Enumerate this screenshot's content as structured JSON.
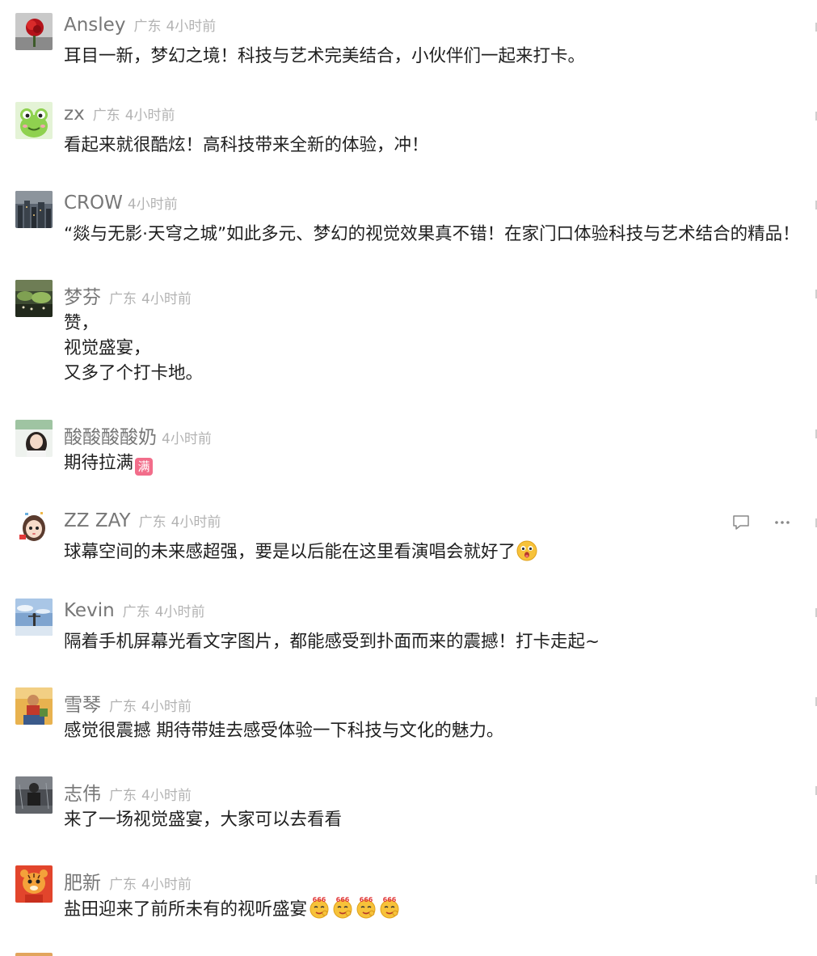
{
  "comments": [
    {
      "name": "Ansley",
      "location": "广东",
      "time": "4小时前",
      "lines": [
        "耳目一新，梦幻之境！科技与艺术完美结合，小伙伴们一起来打卡。"
      ],
      "avatar_icon": "red-rose-avatar-icon"
    },
    {
      "name": "zx",
      "location": "广东",
      "time": "4小时前",
      "lines": [
        "看起来就很酷炫！高科技带来全新的体验，冲！"
      ],
      "avatar_icon": "green-frog-avatar-icon"
    },
    {
      "name": "CROW",
      "location": "",
      "time": "4小时前",
      "lines": [
        "“燚与无影·天穹之城”如此多元、梦幻的视觉效果真不错！在家门口体验科技与艺术结合的精品！"
      ],
      "avatar_icon": "city-night-avatar-icon"
    },
    {
      "name": "梦芬",
      "location": "广东",
      "time": "4小时前",
      "lines": [
        "赞，",
        "视觉盛宴，",
        "又多了个打卡地。"
      ],
      "avatar_icon": "landscape-photo-avatar-icon"
    },
    {
      "name": "酸酸酸酸奶",
      "location": "",
      "time": "4小时前",
      "lines": [
        "期待拉满"
      ],
      "badge": "满",
      "avatar_icon": "girl-photo-avatar-icon"
    },
    {
      "name": "ZZ ZAY",
      "location": "广东",
      "time": "4小时前",
      "lines": [
        "球幕空间的未来感超强，要是以后能在这里看演唱会就好了"
      ],
      "emoji": "surprised-face-emoji",
      "avatar_icon": "cartoon-girl-avatar-icon",
      "actions": {
        "reply_icon": "comment-reply-icon",
        "more_icon": "more-options-icon"
      }
    },
    {
      "name": "Kevin",
      "location": "广东",
      "time": "4小时前",
      "lines": [
        "隔着手机屏幕光看文字图片，都能感受到扑面而来的震撼！打卡走起~"
      ],
      "avatar_icon": "sky-person-avatar-icon"
    },
    {
      "name": "雪琴",
      "location": "广东",
      "time": "4小时前",
      "lines": [
        "感觉很震撼 期待带娃去感受体验一下科技与文化的魅力。"
      ],
      "avatar_icon": "child-photo-avatar-icon"
    },
    {
      "name": "志伟",
      "location": "广东",
      "time": "4小时前",
      "lines": [
        "来了一场视觉盛宴，大家可以去看看"
      ],
      "avatar_icon": "dark-figure-avatar-icon"
    },
    {
      "name": "肥新",
      "location": "广东",
      "time": "4小时前",
      "lines": [
        "盐田迎来了前所未有的视听盛宴"
      ],
      "emoji_repeat": [
        "666-emoji",
        "666-emoji",
        "666-emoji",
        "666-emoji"
      ],
      "emoji_text": "666",
      "avatar_icon": "tiger-cartoon-avatar-icon"
    }
  ],
  "colors": {
    "name": "#777777",
    "meta": "#b3b3b3",
    "text": "#1f1f1f",
    "badge": "#f26d8a"
  }
}
